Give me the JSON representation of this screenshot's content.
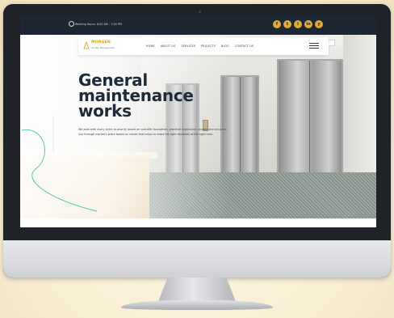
{
  "topbar": {
    "hours_text": "Working Hours: 8:00 AM - 7:00 PM",
    "social_icons": [
      "facebook-icon",
      "twitter-icon",
      "instagram-icon",
      "linkedin-icon",
      "youtube-icon"
    ],
    "social_glyphs": [
      "f",
      "t",
      "i",
      "in",
      "y"
    ]
  },
  "logo": {
    "name": "MORGEN",
    "tagline": "Facility Management"
  },
  "nav": {
    "items": [
      "HOME",
      "ABOUT US",
      "SERVICES",
      "PROJECTS",
      "BLOG",
      "CONTACT US"
    ]
  },
  "hero": {
    "title_line1": "General",
    "title_line2": "maintenance",
    "title_line3": "works",
    "body": "We work with every client to priority based on scientific foundation, practical experience, studies and accounts. Use through market's share based on values that helps us make the right decisions at the right time."
  },
  "colors": {
    "accent": "#e2a93b",
    "dark": "#1d2733",
    "title": "#1d2b3a"
  }
}
